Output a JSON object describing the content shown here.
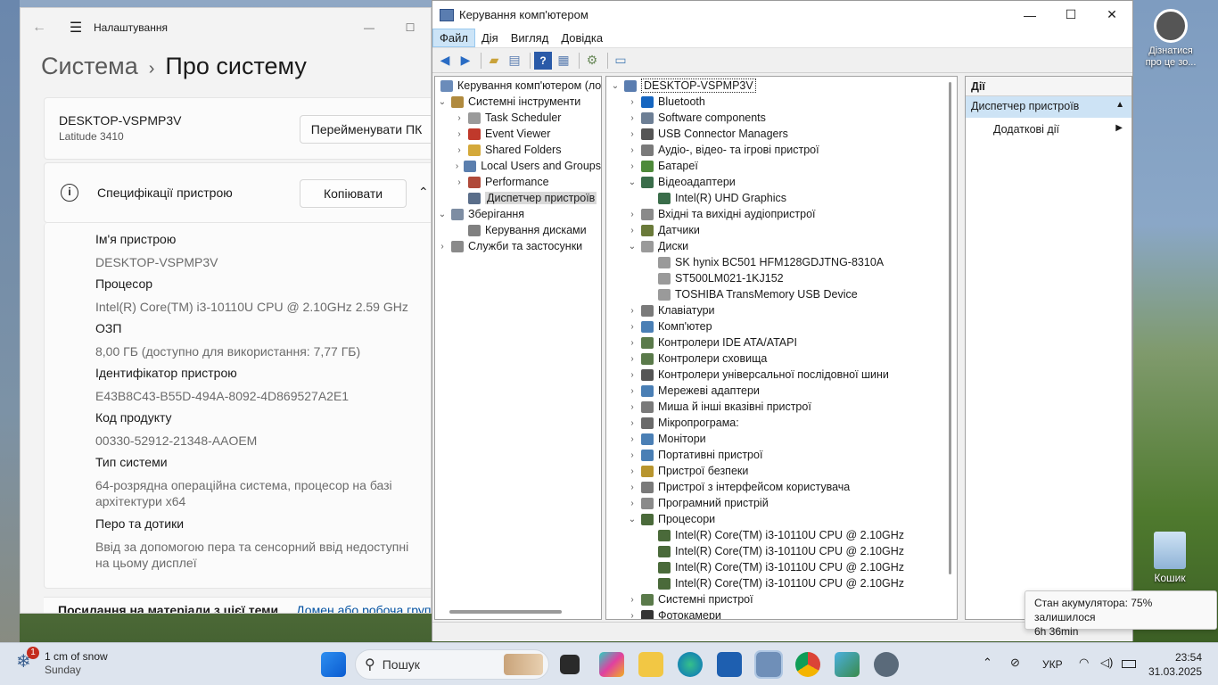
{
  "settings": {
    "app_title": "Налаштування",
    "breadcrumb_parent": "Система",
    "breadcrumb_current": "Про систему",
    "device_name": "DESKTOP-VSPMP3V",
    "device_model": "Latitude 3410",
    "rename_button": "Перейменувати ПК",
    "specs_title": "Специфікації пристрою",
    "copy_button": "Копіювати",
    "specs": [
      {
        "label": "Ім'я пристрою",
        "value": "DESKTOP-VSPMP3V"
      },
      {
        "label": "Процесор",
        "value": "Intel(R) Core(TM) i3-10110U CPU @ 2.10GHz   2.59 GHz"
      },
      {
        "label": "ОЗП",
        "value": "8,00 ГБ (доступно для використання: 7,77 ГБ)"
      },
      {
        "label": "Ідентифікатор пристрою",
        "value": "E43B8C43-B55D-494A-8092-4D869527A2E1"
      },
      {
        "label": "Код продукту",
        "value": "00330-52912-21348-AAOEM"
      },
      {
        "label": "Тип системи",
        "value": "64-розрядна операційна система, процесор на базі архітектури x64"
      },
      {
        "label": "Перо та дотики",
        "value": "Ввід за допомогою пера та сенсорний ввід недоступні на цьому дисплеї"
      }
    ],
    "related_links_title": "Посилання на матеріали з цієї теми",
    "related_link": "Домен або робоча група"
  },
  "cm": {
    "title": "Керування комп'ютером",
    "menu": [
      "Файл",
      "Дія",
      "Вигляд",
      "Довідка"
    ],
    "tree": [
      {
        "label": "Керування комп'ютером (лок",
        "level": 0,
        "exp": "",
        "color": "#6b8cba"
      },
      {
        "label": "Системні інструменти",
        "level": 0,
        "exp": "v",
        "color": "#b08a3e"
      },
      {
        "label": "Task Scheduler",
        "level": 1,
        "exp": ">",
        "color": "#9a9a9a"
      },
      {
        "label": "Event Viewer",
        "level": 1,
        "exp": ">",
        "color": "#c0392b"
      },
      {
        "label": "Shared Folders",
        "level": 1,
        "exp": ">",
        "color": "#d4a93a"
      },
      {
        "label": "Local Users and Groups",
        "level": 1,
        "exp": ">",
        "color": "#5b7fae"
      },
      {
        "label": "Performance",
        "level": 1,
        "exp": ">",
        "color": "#b04a3a"
      },
      {
        "label": "Диспетчер пристроїв",
        "level": 1,
        "exp": "",
        "color": "#5a6e8a",
        "selected": true
      },
      {
        "label": "Зберігання",
        "level": 0,
        "exp": "v",
        "color": "#7d8da3"
      },
      {
        "label": "Керування дисками",
        "level": 1,
        "exp": "",
        "color": "#808080"
      },
      {
        "label": "Служби та застосунки",
        "level": 0,
        "exp": ">",
        "color": "#8a8a8a"
      }
    ],
    "devices": [
      {
        "label": "DESKTOP-VSPMP3V",
        "level": 0,
        "exp": "v",
        "color": "#5a7db0",
        "root": true
      },
      {
        "label": "Bluetooth",
        "level": 1,
        "exp": ">",
        "color": "#1565c0"
      },
      {
        "label": "Software components",
        "level": 1,
        "exp": ">",
        "color": "#6d7f95"
      },
      {
        "label": "USB Connector Managers",
        "level": 1,
        "exp": ">",
        "color": "#555555"
      },
      {
        "label": "Аудіо-, відео- та ігрові пристрої",
        "level": 1,
        "exp": ">",
        "color": "#7a7a7a"
      },
      {
        "label": "Батареї",
        "level": 1,
        "exp": ">",
        "color": "#4e8a3a"
      },
      {
        "label": "Відеоадаптери",
        "level": 1,
        "exp": "v",
        "color": "#3a6d4a"
      },
      {
        "label": "Intel(R) UHD Graphics",
        "level": 2,
        "exp": "",
        "color": "#3a6d4a"
      },
      {
        "label": "Вхідні та вихідні аудіопристрої",
        "level": 1,
        "exp": ">",
        "color": "#8a8a8a"
      },
      {
        "label": "Датчики",
        "level": 1,
        "exp": ">",
        "color": "#6a7a3a"
      },
      {
        "label": "Диски",
        "level": 1,
        "exp": "v",
        "color": "#9a9a9a"
      },
      {
        "label": "SK hynix BC501 HFM128GDJTNG-8310A",
        "level": 2,
        "exp": "",
        "color": "#9a9a9a"
      },
      {
        "label": "ST500LM021-1KJ152",
        "level": 2,
        "exp": "",
        "color": "#9a9a9a"
      },
      {
        "label": "TOSHIBA TransMemory USB Device",
        "level": 2,
        "exp": "",
        "color": "#9a9a9a"
      },
      {
        "label": "Клавіатури",
        "level": 1,
        "exp": ">",
        "color": "#7a7a7a"
      },
      {
        "label": "Комп'ютер",
        "level": 1,
        "exp": ">",
        "color": "#4a7fb5"
      },
      {
        "label": "Контролери IDE ATA/ATAPI",
        "level": 1,
        "exp": ">",
        "color": "#5a7a4a"
      },
      {
        "label": "Контролери сховища",
        "level": 1,
        "exp": ">",
        "color": "#5a7a4a"
      },
      {
        "label": "Контролери універсальної послідовної шини",
        "level": 1,
        "exp": ">",
        "color": "#555555"
      },
      {
        "label": "Мережеві адаптери",
        "level": 1,
        "exp": ">",
        "color": "#4a7fb5"
      },
      {
        "label": "Миша й інші вказівні пристрої",
        "level": 1,
        "exp": ">",
        "color": "#7a7a7a"
      },
      {
        "label": "Мікропрограма:",
        "level": 1,
        "exp": ">",
        "color": "#6a6a6a"
      },
      {
        "label": "Монітори",
        "level": 1,
        "exp": ">",
        "color": "#4a7fb5"
      },
      {
        "label": "Портативні пристрої",
        "level": 1,
        "exp": ">",
        "color": "#4a7fb5"
      },
      {
        "label": "Пристрої безпеки",
        "level": 1,
        "exp": ">",
        "color": "#b8952e"
      },
      {
        "label": "Пристрої з інтерфейсом користувача",
        "level": 1,
        "exp": ">",
        "color": "#7a7a7a"
      },
      {
        "label": "Програмний пристрій",
        "level": 1,
        "exp": ">",
        "color": "#8a8a8a"
      },
      {
        "label": "Процесори",
        "level": 1,
        "exp": "v",
        "color": "#4a6a3a"
      },
      {
        "label": "Intel(R) Core(TM) i3-10110U CPU @ 2.10GHz",
        "level": 2,
        "exp": "",
        "color": "#4a6a3a"
      },
      {
        "label": "Intel(R) Core(TM) i3-10110U CPU @ 2.10GHz",
        "level": 2,
        "exp": "",
        "color": "#4a6a3a"
      },
      {
        "label": "Intel(R) Core(TM) i3-10110U CPU @ 2.10GHz",
        "level": 2,
        "exp": "",
        "color": "#4a6a3a"
      },
      {
        "label": "Intel(R) Core(TM) i3-10110U CPU @ 2.10GHz",
        "level": 2,
        "exp": "",
        "color": "#4a6a3a"
      },
      {
        "label": "Системні пристрої",
        "level": 1,
        "exp": ">",
        "color": "#5a7a4a"
      },
      {
        "label": "Фотокамери",
        "level": 1,
        "exp": ">",
        "color": "#333333"
      }
    ],
    "actions_title": "Дії",
    "actions_section": "Диспетчер пристроїв",
    "actions_item": "Додаткові дії"
  },
  "tooltip": {
    "line1": "Стан акумулятора: 75% залишилося",
    "line2": "6h 36min"
  },
  "desktop": {
    "activate_label": "Дізнатися про це зо...",
    "recycle_label": "Кошик"
  },
  "taskbar": {
    "weather_text": "1 cm of snow",
    "weather_sub": "Sunday",
    "weather_badge": "1",
    "search_placeholder": "Пошук",
    "language": "УКР",
    "time": "23:54",
    "date": "31.03.2025"
  }
}
